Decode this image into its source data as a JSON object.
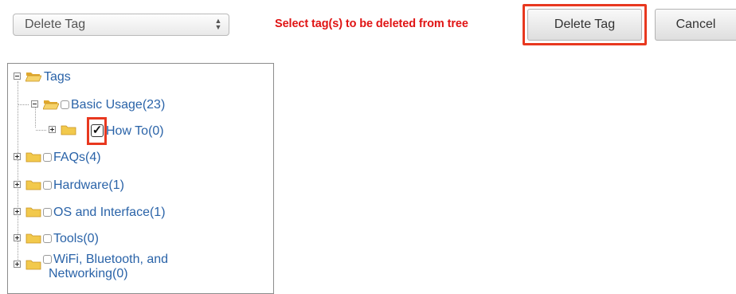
{
  "toolbar": {
    "select_value": "Delete Tag",
    "select_arrows": "▲▼",
    "message": "Select tag(s) to be deleted from tree",
    "delete_label": "Delete Tag",
    "cancel_label": "Cancel"
  },
  "tree": {
    "root": {
      "label": "Tags",
      "expanded": true
    },
    "items": [
      {
        "label": "Basic Usage(23)",
        "expanded": true,
        "checked": false,
        "level": 1
      },
      {
        "label": "How To(0)",
        "expanded": false,
        "checked": true,
        "level": 2
      },
      {
        "label": "FAQs(4)",
        "expanded": false,
        "checked": false,
        "level": 1
      },
      {
        "label": "Hardware(1)",
        "expanded": false,
        "checked": false,
        "level": 1
      },
      {
        "label": "OS and Interface(1)",
        "expanded": false,
        "checked": false,
        "level": 1
      },
      {
        "label": "Tools(0)",
        "expanded": false,
        "checked": false,
        "level": 1
      },
      {
        "label": "WiFi, Bluetooth, and",
        "label_line2": "Networking(0)",
        "expanded": false,
        "checked": false,
        "level": 1
      }
    ]
  },
  "colors": {
    "highlight": "#e8381f",
    "message": "#e01414",
    "link": "#2a63a8",
    "folder": "#f2c94c"
  }
}
